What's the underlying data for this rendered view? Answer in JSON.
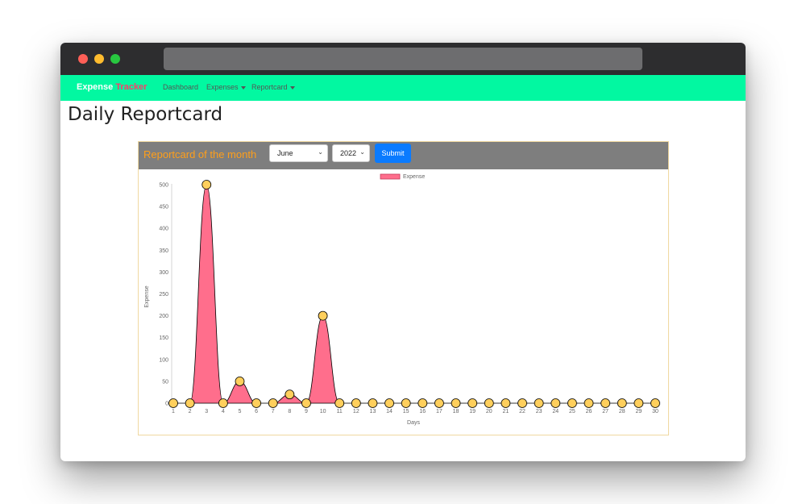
{
  "navbar": {
    "brand_part1": "Expense",
    "brand_part2": "Tracker",
    "items": [
      {
        "label": "Dashboard",
        "dropdown": false
      },
      {
        "label": "Expenses",
        "dropdown": true
      },
      {
        "label": "Reportcard",
        "dropdown": true
      }
    ]
  },
  "page": {
    "title": "Daily Reportcard"
  },
  "card": {
    "title": "Reportcard of the month",
    "month_select": "June",
    "year_select": "2022",
    "submit_label": "Submit"
  },
  "colors": {
    "navbar": "#02f8a1",
    "brand_accent": "#ff3b6b",
    "card_title": "#ff9f1a",
    "area_fill": "#ff6e8c",
    "point_fill": "#ffcf5c",
    "submit": "#0a7bff"
  },
  "chart_data": {
    "type": "area",
    "x": [
      1,
      2,
      3,
      4,
      5,
      6,
      7,
      8,
      9,
      10,
      11,
      12,
      13,
      14,
      15,
      16,
      17,
      18,
      19,
      20,
      21,
      22,
      23,
      24,
      25,
      26,
      27,
      28,
      29,
      30
    ],
    "series": [
      {
        "name": "Expense",
        "values": [
          0,
          0,
          500,
          0,
          50,
          0,
          0,
          20,
          0,
          200,
          0,
          0,
          0,
          0,
          0,
          0,
          0,
          0,
          0,
          0,
          0,
          0,
          0,
          0,
          0,
          0,
          0,
          0,
          0,
          0
        ]
      }
    ],
    "xlabel": "Days",
    "ylabel": "Expense",
    "ylim": [
      0,
      500
    ],
    "yticks": [
      0,
      50,
      100,
      150,
      200,
      250,
      300,
      350,
      400,
      450,
      500
    ],
    "legend": "top-center",
    "grid": false
  }
}
